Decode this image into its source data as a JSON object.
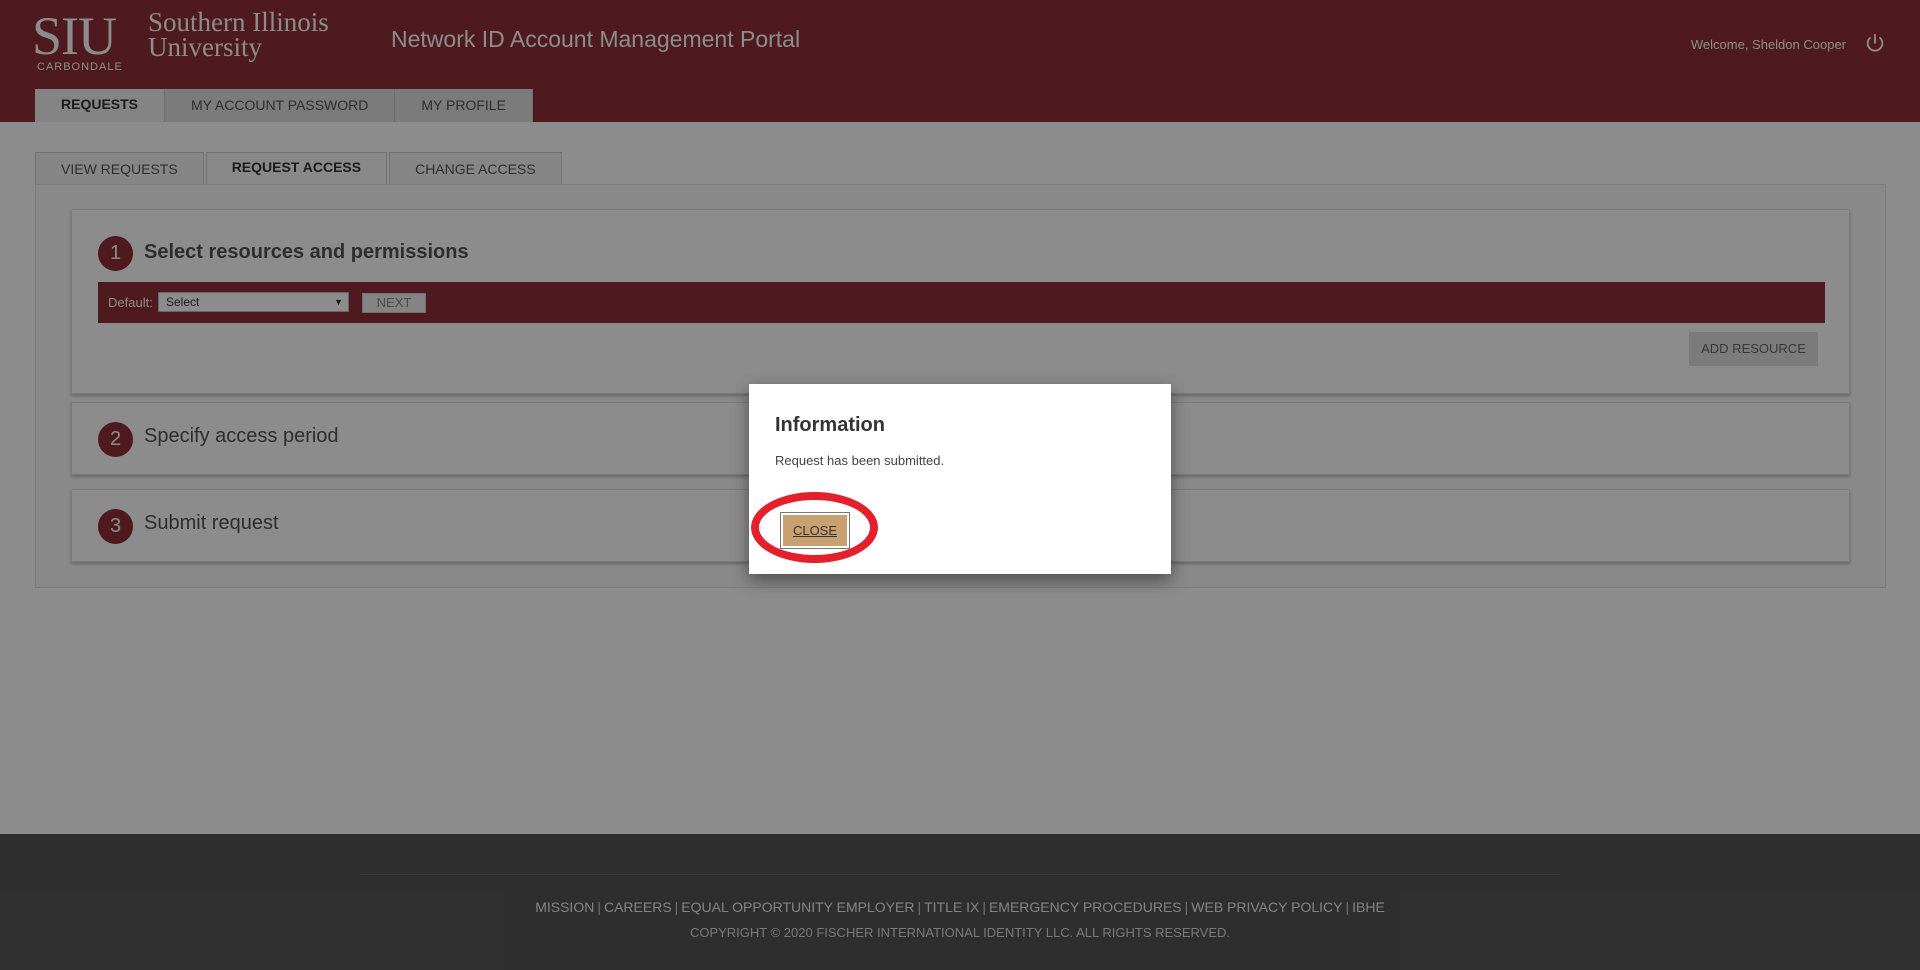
{
  "header": {
    "logo_siu": "SIU",
    "logo_carbondale": "CARBONDALE",
    "logo_southern": "Southern Illinois",
    "logo_university": "University",
    "portal_title": "Network ID Account Management Portal",
    "welcome": "Welcome, Sheldon Cooper",
    "power_icon": "power-icon"
  },
  "main_tabs": [
    {
      "label": "REQUESTS",
      "active": true
    },
    {
      "label": "MY ACCOUNT PASSWORD",
      "active": false
    },
    {
      "label": "MY PROFILE",
      "active": false
    }
  ],
  "sub_tabs": [
    {
      "label": "VIEW REQUESTS",
      "active": false
    },
    {
      "label": "REQUEST ACCESS",
      "active": true
    },
    {
      "label": "CHANGE ACCESS",
      "active": false
    }
  ],
  "steps": [
    {
      "number": "1",
      "title": "Select resources and permissions"
    },
    {
      "number": "2",
      "title": "Specify access period"
    },
    {
      "number": "3",
      "title": "Submit request"
    }
  ],
  "step1": {
    "default_label": "Default:",
    "select_value": "Select",
    "next_label": "NEXT",
    "add_resource_label": "ADD RESOURCE"
  },
  "footer": {
    "links": [
      "MISSION",
      "CAREERS",
      "EQUAL OPPORTUNITY EMPLOYER",
      "TITLE IX",
      "EMERGENCY PROCEDURES",
      "WEB PRIVACY POLICY",
      "IBHE"
    ],
    "copyright": "COPYRIGHT © 2020 FISCHER INTERNATIONAL IDENTITY LLC. ALL RIGHTS RESERVED."
  },
  "modal": {
    "title": "Information",
    "message": "Request has been submitted.",
    "close_label": "CLOSE"
  },
  "colors": {
    "brand": "#8f303a",
    "close_button": "#c9a06f",
    "highlight_ring": "#e3202b"
  }
}
